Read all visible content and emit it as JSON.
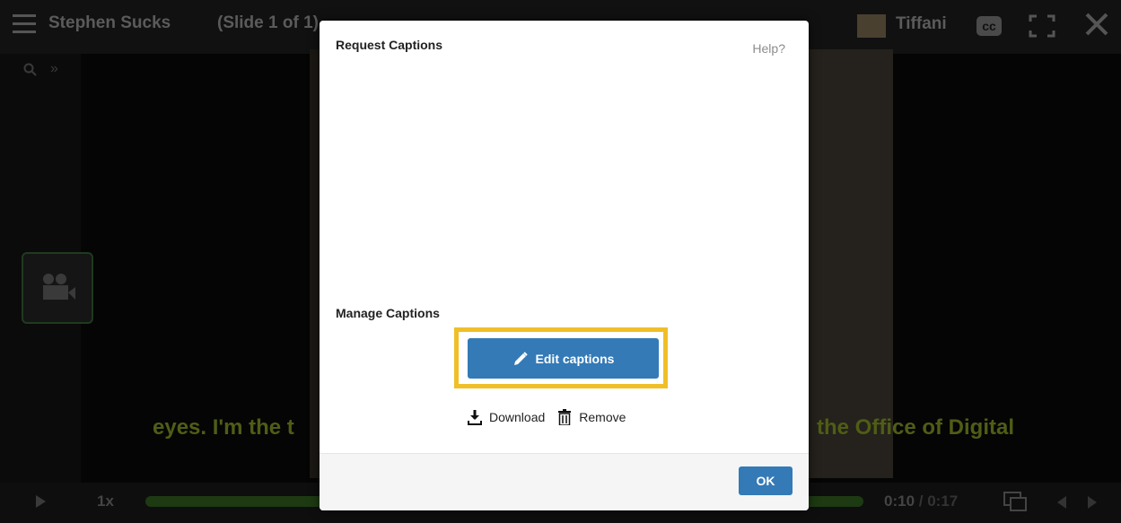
{
  "player": {
    "title": "Stephen Sucks",
    "slide_info": "(Slide 1 of 1)",
    "user_name": "Tiffani",
    "cc_label": "cc",
    "caption_left": "eyes. I'm the t",
    "caption_right": "the Office of Digital",
    "speed": "1x",
    "time_current": "0:10",
    "time_total": "/ 0:17"
  },
  "modal": {
    "title": "Request Captions",
    "help": "Help?",
    "manage_title": "Manage Captions",
    "edit_label": "Edit captions",
    "download_label": "Download",
    "remove_label": "Remove",
    "ok_label": "OK"
  },
  "colors": {
    "primary_button": "#337ab7",
    "highlight": "#f0bf27"
  }
}
